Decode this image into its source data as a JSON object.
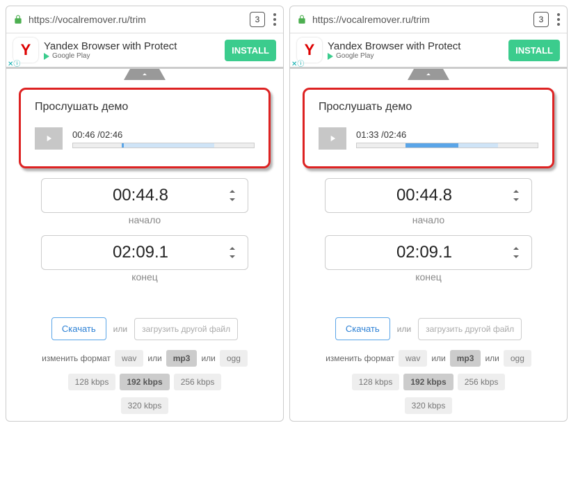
{
  "url": "https://vocalremover.ru/trim",
  "tab_count": "3",
  "ad": {
    "logo": "Y",
    "title": "Yandex Browser with Protect",
    "store": "Google Play",
    "cta": "INSTALL"
  },
  "demo": {
    "title": "Прослушать демо"
  },
  "left": {
    "time": "00:46 /02:46",
    "light_left": "27%",
    "light_width": "51%",
    "dark_left": "27%",
    "dark_width": "1%"
  },
  "right": {
    "time": "01:33 /02:46",
    "light_left": "27%",
    "light_width": "51%",
    "dark_left": "27%",
    "dark_width": "29%"
  },
  "start": {
    "value": "00:44.8",
    "label": "начало"
  },
  "end": {
    "value": "02:09.1",
    "label": "конец"
  },
  "actions": {
    "download": "Скачать",
    "or": "или",
    "upload": "загрузить другой файл"
  },
  "format": {
    "label": "изменить формат",
    "wav": "wav",
    "mp3": "mp3",
    "ogg": "ogg"
  },
  "bitrates": {
    "b128": "128 kbps",
    "b192": "192 kbps",
    "b256": "256 kbps",
    "b320": "320 kbps"
  }
}
